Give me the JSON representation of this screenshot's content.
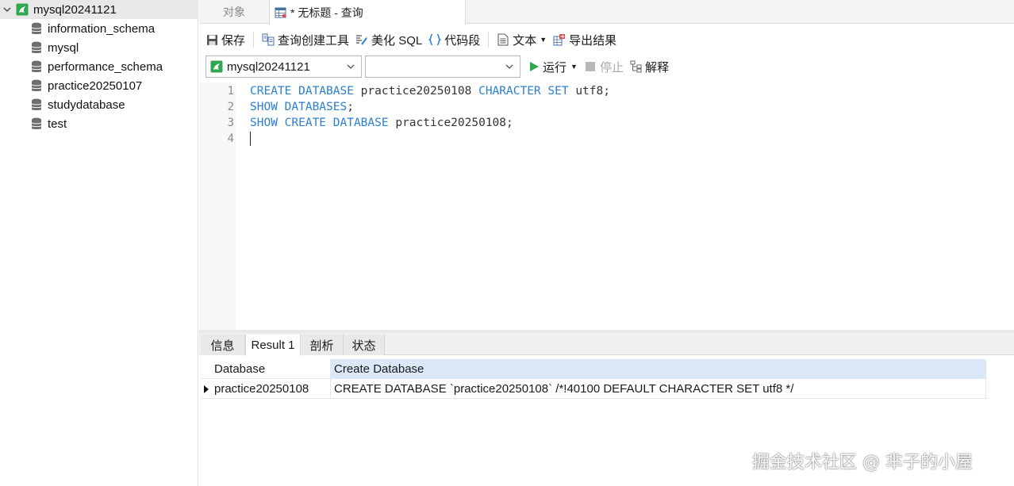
{
  "sidebar": {
    "connection": {
      "label": "mysql20241121",
      "icon": "mysql-connection-icon",
      "expanded": true
    },
    "databases": [
      {
        "label": "information_schema"
      },
      {
        "label": "mysql"
      },
      {
        "label": "performance_schema"
      },
      {
        "label": "practice20250107"
      },
      {
        "label": "studydatabase"
      },
      {
        "label": "test"
      }
    ]
  },
  "tabs": {
    "objects": "对象",
    "query": "* 无标题 - 查询"
  },
  "toolbar": {
    "save": "保存",
    "query_builder": "查询创建工具",
    "beautify": "美化 SQL",
    "snippet": "代码段",
    "text": "文本",
    "export": "导出结果"
  },
  "selectors": {
    "connection": "mysql20241121",
    "database": "",
    "run": "运行",
    "stop": "停止",
    "explain": "解释"
  },
  "editor": {
    "line_numbers": [
      "1",
      "2",
      "3",
      "4"
    ],
    "lines": [
      [
        {
          "t": "CREATE DATABASE",
          "kw": true
        },
        {
          "t": " practice20250108 "
        },
        {
          "t": "CHARACTER SET",
          "kw": true
        },
        {
          "t": " utf8;"
        }
      ],
      [
        {
          "t": "SHOW DATABASES",
          "kw": true
        },
        {
          "t": ";"
        }
      ],
      [
        {
          "t": "SHOW CREATE DATABASE",
          "kw": true
        },
        {
          "t": " practice20250108;"
        }
      ],
      []
    ]
  },
  "result_tabs": {
    "info": "信息",
    "result1": "Result 1",
    "profile": "剖析",
    "status": "状态"
  },
  "result_grid": {
    "columns": [
      "Database",
      "Create Database"
    ],
    "rows": [
      [
        "practice20250108",
        "CREATE DATABASE `practice20250108` /*!40100 DEFAULT CHARACTER SET utf8 */"
      ]
    ]
  },
  "watermark": "掘金技术社区 @ 芈子的小屋",
  "colors": {
    "keyword": "#2b7fd0",
    "run_green": "#2fa84f",
    "header_selected": "#dbe8f8"
  }
}
